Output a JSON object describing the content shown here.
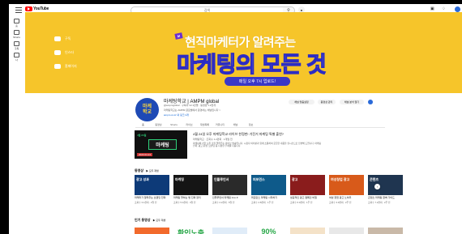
{
  "topbar": {
    "logo_text": "YouTube",
    "search_placeholder": "검색",
    "search_icon": "search-icon",
    "mic_icon": "mic-icon",
    "right_icons": [
      "create-icon",
      "notifications-icon",
      "avatar"
    ]
  },
  "sidebar": {
    "items": [
      {
        "label": "홈",
        "icon": "home-icon"
      },
      {
        "label": "Shorts",
        "icon": "shorts-icon"
      },
      {
        "label": "구독",
        "icon": "subscriptions-icon"
      },
      {
        "label": "나",
        "icon": "you-icon"
      }
    ]
  },
  "banner": {
    "links": [
      {
        "label": "구독",
        "icon": "youtube-icon"
      },
      {
        "label": "인스타",
        "icon": "like-icon"
      },
      {
        "label": "홈페이지",
        "icon": "web-icon"
      }
    ],
    "subtitle": "현직마케터가 알려주는",
    "title": "마케팅의 모든 것",
    "pill": "매일 오후 7시 업로드!",
    "bg_color": "#f6c52a",
    "accent_color": "#3a38c8"
  },
  "channel": {
    "avatar_text_1": "마케",
    "avatar_text_2": "학교",
    "name": "마케팅학교 | AMPM global",
    "meta": "@ampmglobal · 구독자 12.1만명 · 동영상 1.2천개",
    "desc": "마케팅학교는 AMPM 글로벌에서 운영하는 채널입니다 >",
    "link": "ampm.co.kr 외 링크 2개",
    "buttons": [
      "채널 맞춤설정",
      "동영상 관리",
      "채널 분석 열기"
    ]
  },
  "tabs": [
    "홈",
    "동영상",
    "Shorts",
    "라이브",
    "재생목록",
    "커뮤니티",
    "채널",
    "정보"
  ],
  "featured": {
    "thumb_top": "4월 24일",
    "thumb_box": "마케팅",
    "thumb_bottom": "2023.04.24",
    "title": "4월 24일 오후 마케팅학교 라이브 한정판! 가진거 마케팅 특별 출연?",
    "meta": "마케팅학교 · 조회수 1.2만회 · 1개월 전",
    "desc": "마케팅에 관한 모든 것을 알려주는 라이브 방송입니다. 시청자 여러분과 함께 소통하며 궁금한 내용을 실시간으로 답변해 드립니다. 마케팅 전략, 광고 운영, 브랜딩 등 다양한 주제를 다룹니다."
  },
  "sections": [
    {
      "title": "동영상",
      "play_label": "모두 재생"
    },
    {
      "title": "인기 동영상",
      "play_label": "모두 재생"
    }
  ],
  "videos": [
    {
      "title": "마케터가 알려주는 브랜딩 전략",
      "meta": "조회수 3.1천회 · 2일 전",
      "thumb": "광고 성과",
      "color": "#0d3a78"
    },
    {
      "title": "마케팅 잘하는 법 진짜 정리",
      "meta": "조회수 5.4천회 · 4일 전",
      "thumb": "마케팅",
      "color": "#151515"
    },
    {
      "title": "인플루언서 마케팅 A to Z",
      "meta": "조회수 2.2천회 · 6일 전",
      "thumb": "인플루언서",
      "color": "#2a2a2a"
    },
    {
      "title": "퍼포먼스 마케팅 시작하기",
      "meta": "조회수 4.8천회 · 1주 전",
      "thumb": "퍼포먼스",
      "color": "#0e5a8a"
    },
    {
      "title": "성공적인 광고 캠페인 비밀",
      "meta": "조회수 6.0천회 · 1주 전",
      "thumb": "광고",
      "color": "#8a1c1c"
    },
    {
      "title": "여성 창업 광고 노하우",
      "meta": "조회수 3.9천회 · 2주 전",
      "thumb": "여성창업 광고",
      "color": "#d85a1a"
    },
    {
      "title": "콘텐츠 마케팅 완벽 가이드",
      "meta": "조회수 7.2천회 · 2주 전",
      "thumb": "콘텐츠",
      "color": "#1f3550"
    }
  ],
  "popular_thumbs": [
    {
      "thumb": "",
      "color": "#f26a2c"
    },
    {
      "thumb": "확인노출",
      "color": "#ffffff"
    },
    {
      "thumb": "",
      "color": "#e0ecf8"
    },
    {
      "thumb": "90%",
      "color": "#ffffff"
    },
    {
      "thumb": "",
      "color": "#f4e2c8"
    },
    {
      "thumb": "",
      "color": "#e8e8e8"
    },
    {
      "thumb": "",
      "color": "#c9b9a8"
    }
  ]
}
